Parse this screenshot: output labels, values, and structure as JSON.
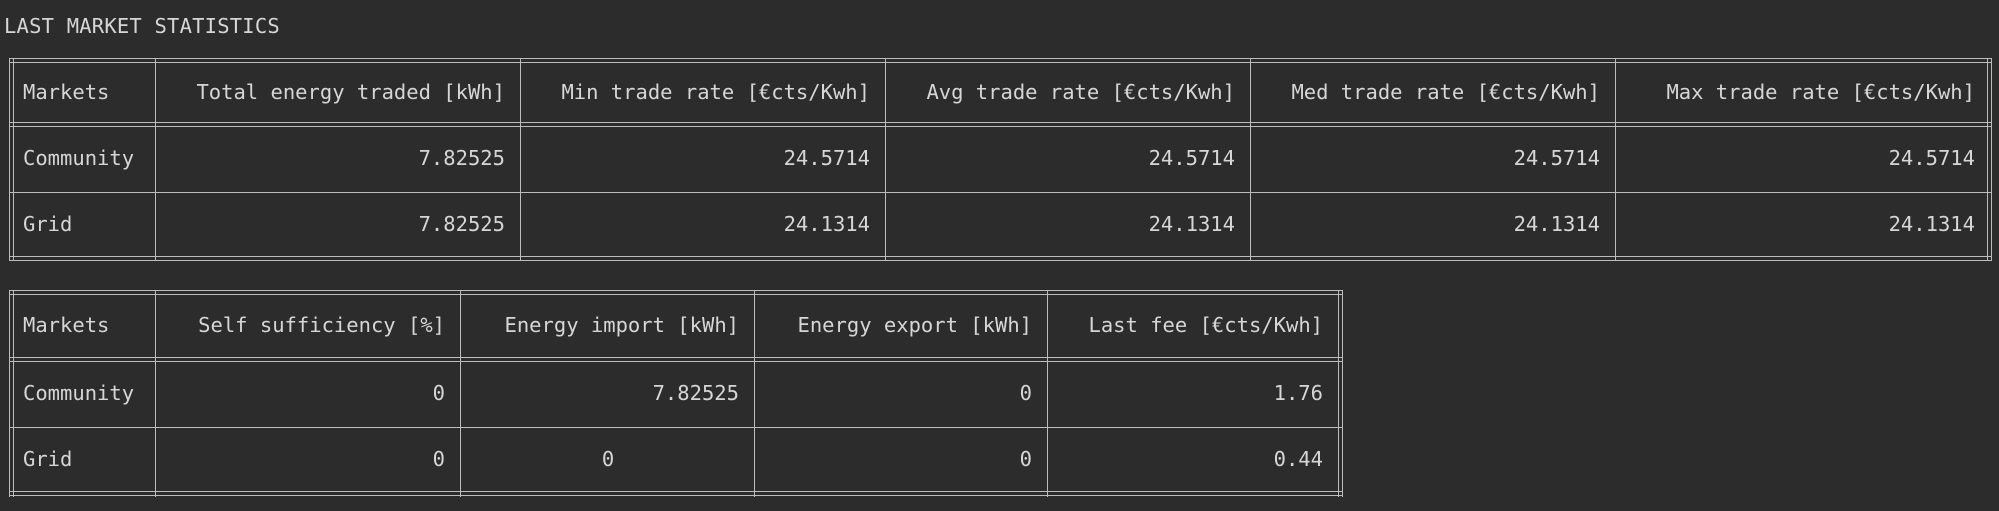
{
  "title": "LAST MARKET STATISTICS",
  "table1": {
    "headers": [
      "Markets",
      "Total energy traded [kWh]",
      "Min trade rate [€cts/Kwh]",
      "Avg trade rate [€cts/Kwh]",
      "Med trade rate [€cts/Kwh]",
      "Max trade rate [€cts/Kwh]"
    ],
    "rows": [
      [
        "Community",
        "7.82525",
        "24.5714",
        "24.5714",
        "24.5714",
        "24.5714"
      ],
      [
        "Grid",
        "7.82525",
        "24.1314",
        "24.1314",
        "24.1314",
        "24.1314"
      ]
    ]
  },
  "table2": {
    "headers": [
      "Markets",
      "Self sufficiency [%]",
      "Energy import [kWh]",
      "Energy export [kWh]",
      "Last fee [€cts/Kwh]"
    ],
    "rows": [
      [
        "Community",
        "0",
        "7.82525",
        "0",
        "1.76"
      ],
      [
        "Grid",
        "0",
        "0",
        "0",
        "0.44"
      ]
    ]
  }
}
